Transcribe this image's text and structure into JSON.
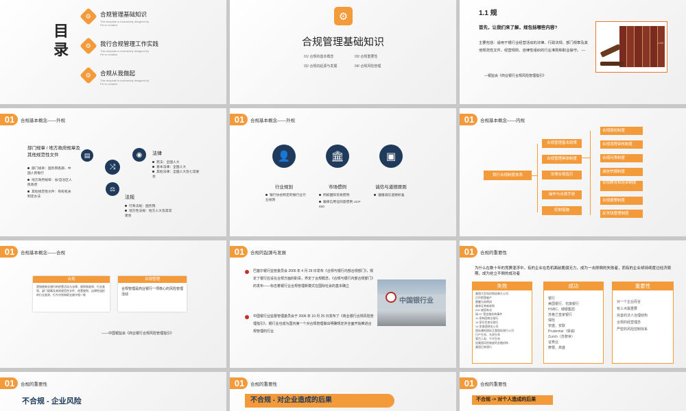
{
  "s1": {
    "title": "目录",
    "items": [
      {
        "label": "合规管理基础知识",
        "sub": "This template is exclusively designed by Fei er creative"
      },
      {
        "label": "我行合规管理工作实践",
        "sub": "This template is exclusively designed by Fei er creative"
      },
      {
        "label": "合规从我做起",
        "sub": "This template is exclusively designed by Fei er creative"
      }
    ]
  },
  "s2": {
    "title": "合规管理基础知识",
    "items": [
      "01/ 合规的基本概念",
      "03/ 合规重要性",
      "02/ 合规的起源与发展",
      "04/ 合规风险管理"
    ]
  },
  "s3": {
    "heading": "1.1  规",
    "question": "首先，让我们来了解，规包括哪些内容?",
    "body": "主要包括：适用于银行业经营活动的法律、行政法规、部门规章及其他规范性文件、经营规则、自律性组织的行业准则和职业操守。 —",
    "source": "—银监会《商业银行合规风险管理指引》",
    "book_label": "LAW"
  },
  "s4": {
    "num": "01",
    "title": "合规基本概念——外规",
    "left_title": "部门规章 / 地方政府规章及其他规范性文件",
    "left_items": [
      "部门规章：国务院各部、中国人民银行",
      "地方政府规章：省/自治区人民政府",
      "其他规范性文件：有权机关制定办法"
    ],
    "law_title": "法律",
    "law_items": [
      "宪法：全国人大",
      "基本法律：全国人大",
      "其他法律：全国人大及七常委会"
    ],
    "reg_title": "法规",
    "reg_items": [
      "行政法规：国务院",
      "地方性法规：地方人大及其常委会"
    ]
  },
  "s5": {
    "num": "01",
    "title": "合规基本概念——外规",
    "cols": [
      {
        "label": "行业规划",
        "items": [
          "银行协会制定的银行业行业规则"
        ]
      },
      {
        "label": "市场惯例",
        "items": [
          "例如国际贸易惯例",
          "跟单信用证同意惯例 UCP 600"
        ]
      },
      {
        "label": "诚信与道德原则",
        "items": [
          "遵循诚信道德标准"
        ]
      }
    ]
  },
  "s6": {
    "num": "01",
    "title": "合规基本概念——内规",
    "root": "我行合规制度体系",
    "mid": [
      "合规管理基本政策",
      "合规管理具体制度",
      "法律合规指引",
      "操作与合规手册",
      "控制措施"
    ],
    "right": [
      "合规授权制度",
      "合规流程审核制度",
      "合规问责制度",
      "诚信举报制度",
      "合规教育和培训制度",
      "合规报警制度",
      "反洗钱管理制度"
    ]
  },
  "s7": {
    "num": "01",
    "title": "合规基本概念——合规",
    "box1_head": "合规",
    "box1_text": "是指使商业银行的经营活动与法律、规则和准则、行业准则、部门规章及其他规范性文件、经营规则、自律性组织的行业准则、行为守则和职业操守相一致",
    "box2_head": "合规管理",
    "box2_text": "合规管理是商业银行一项核心的风险管理活动",
    "source": "——中国银监会《商业银行合规风险管理指引》"
  },
  "s8": {
    "num": "01",
    "title": "合规的起源与发展",
    "items": [
      "巴塞尔银行监管委员会 2005 年 4 月 29 日发布《合规与银行内部合规部门》，规定了银行应设在合规方面的职责，界定了合规概念，《合规与银行内部合规部门》的发布——标志着银行业合规管理新模式在国际社会的基本确立",
      "中国银行业监督管理委员会于 2006 年 10 月 25 日发布了《商业银行合规风险管理指引》，银行业也成为国内第一个对合规管理做出明确规定并全面开始推进合规管理的行业"
    ],
    "photo_text": "中国银行业"
  },
  "s9": {
    "num": "01",
    "title": "合规的重要性",
    "question": "为什么在数十年的竞赛混浮中，有的企业在危机面前脆弱无力，成为一击即倒的失败者，而有的企业却持续度过经济周期，成为屹立不倒的成功者",
    "fail_head": "失败",
    "fail_items": [
      "美国大型电机和加拿大公司",
      "贝尔斯登破产",
      "雷曼兄弟倒闭",
      "美林证券被收购",
      "AIG 被国有化",
      "瑞 ST 营金融机构事件",
      "10 家韩国商业银行",
      "16 家印尼商业银行",
      "14 家泰国财务公司",
      "国际康柏国际互惠国际银行公司",
      "日产生命、东邦生命",
      "第百人寿、千代生命",
      "因美国风险制度的金融机构",
      "美国巴林银行"
    ],
    "succ_head": "成功",
    "succ_items": [
      "银行",
      "美国银行、花旗银行",
      "HSBC、瑞银集团",
      "苏格兰皇家银行",
      "保险",
      "安盛、安联",
      "Prudential（保诚）",
      "Zurich（苏黎世）",
      "证券业",
      "摩根、高盛"
    ],
    "imp_head": "重要性",
    "imp_items": [
      "对一个企业而言",
      "有三点最重要",
      "完善的法人治理结构",
      "合规的经营理念",
      "严密的风险控制体系"
    ]
  },
  "s10": {
    "num": "01",
    "title": "合规的重要性",
    "banner": "不合规 - 企业风险"
  },
  "s11": {
    "num": "01",
    "title": "合规的重要性",
    "banner": "不合规 - 对企业造成的后果"
  },
  "s12": {
    "num": "01",
    "title": "合规的重要性",
    "banner": "不合规 -> 对个人造成的后果"
  },
  "colors": {
    "accent": "#f39b3b",
    "dark": "#1f3a5a",
    "red": "#c0302a"
  }
}
